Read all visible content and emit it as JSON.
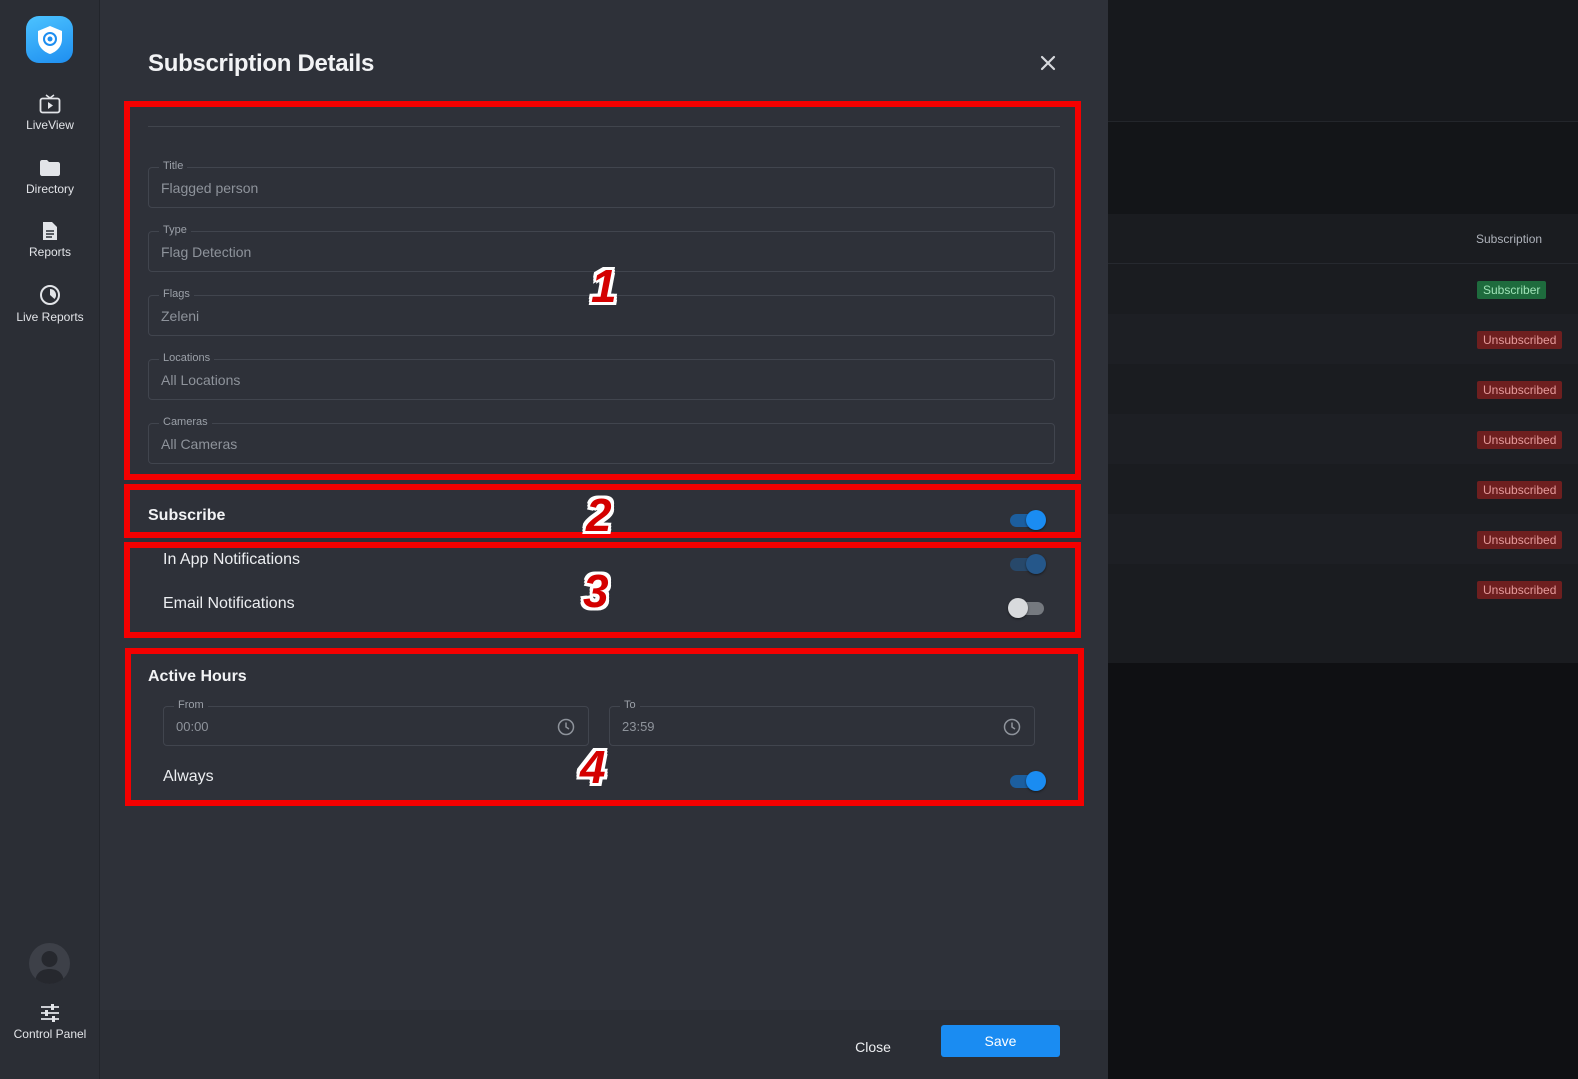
{
  "sidebar": {
    "items": [
      {
        "label": "LiveView",
        "icon": "tv-play-icon"
      },
      {
        "label": "Directory",
        "icon": "folder-icon"
      },
      {
        "label": "Reports",
        "icon": "document-icon"
      },
      {
        "label": "Live Reports",
        "icon": "chart-pie-icon"
      }
    ],
    "bottom": {
      "label": "Control Panel",
      "icon": "sliders-icon"
    }
  },
  "background_table": {
    "column_header": "Subscription",
    "rows": [
      "Subscriber",
      "Unsubscribed",
      "Unsubscribed",
      "Unsubscribed",
      "Unsubscribed",
      "Unsubscribed",
      "Unsubscribed"
    ]
  },
  "modal": {
    "title": "Subscription Details",
    "fields": [
      {
        "label": "Title",
        "value": "Flagged person"
      },
      {
        "label": "Type",
        "value": "Flag Detection"
      },
      {
        "label": "Flags",
        "value": "Zeleni"
      },
      {
        "label": "Locations",
        "value": "All Locations"
      },
      {
        "label": "Cameras",
        "value": "All Cameras"
      }
    ],
    "subscribe": {
      "label": "Subscribe",
      "on": true
    },
    "notifications": [
      {
        "label": "In App Notifications",
        "on": true
      },
      {
        "label": "Email Notifications",
        "on": false
      }
    ],
    "active_hours": {
      "title": "Active Hours",
      "from": {
        "label": "From",
        "value": "00:00"
      },
      "to": {
        "label": "To",
        "value": "23:59"
      },
      "always": {
        "label": "Always",
        "on": true
      }
    },
    "buttons": {
      "close": "Close",
      "save": "Save"
    }
  },
  "annotations": [
    "1",
    "2",
    "3",
    "4"
  ],
  "colors": {
    "accent": "#1a8cf2",
    "annotation": "#f40000",
    "subscriber": "#1e6b3d",
    "unsubscribed": "#6e1f1f"
  }
}
